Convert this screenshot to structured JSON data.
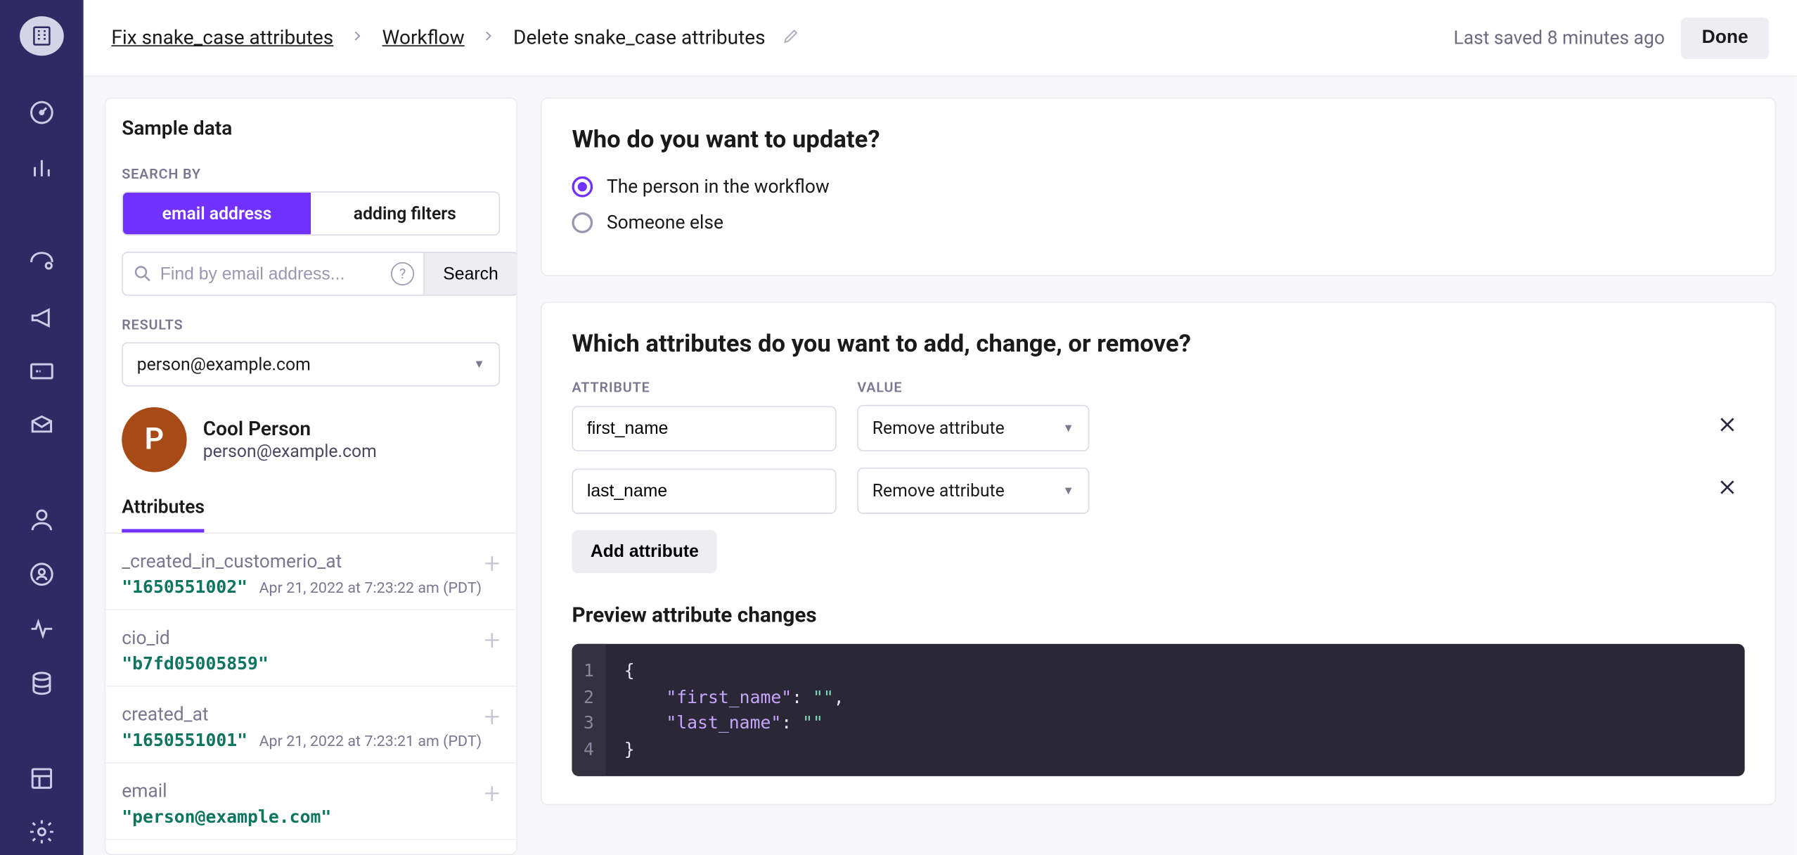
{
  "breadcrumb": {
    "root": "Fix snake_case attributes",
    "mid": "Workflow",
    "current": "Delete snake_case attributes"
  },
  "topbar": {
    "saved": "Last saved 8 minutes ago",
    "done": "Done"
  },
  "samplePanel": {
    "title": "Sample data",
    "searchBy": "SEARCH BY",
    "seg": {
      "email": "email address",
      "filters": "adding filters"
    },
    "searchPlaceholder": "Find by email address...",
    "searchButton": "Search",
    "resultsLabel": "RESULTS",
    "selectedResult": "person@example.com",
    "avatarLetter": "P",
    "personName": "Cool Person",
    "personEmail": "person@example.com",
    "tab": "Attributes",
    "attributes": [
      {
        "key": "_created_in_customerio_at",
        "value": "\"1650551002\"",
        "meta": "Apr 21, 2022 at 7:23:22 am (PDT)"
      },
      {
        "key": "cio_id",
        "value": "\"b7fd05005859\"",
        "meta": ""
      },
      {
        "key": "created_at",
        "value": "\"1650551001\"",
        "meta": "Apr 21, 2022 at 7:23:21 am (PDT)"
      },
      {
        "key": "email",
        "value": "\"person@example.com\"",
        "meta": ""
      }
    ]
  },
  "updateCard": {
    "heading": "Who do you want to update?",
    "opt1": "The person in the workflow",
    "opt2": "Someone else"
  },
  "attrCard": {
    "heading": "Which attributes do you want to add, change, or remove?",
    "colAttr": "ATTRIBUTE",
    "colVal": "VALUE",
    "rows": [
      {
        "attr": "first_name",
        "val": "Remove attribute"
      },
      {
        "attr": "last_name",
        "val": "Remove attribute"
      }
    ],
    "addBtn": "Add attribute",
    "previewHeading": "Preview attribute changes",
    "code": {
      "lines": [
        "1",
        "2",
        "3",
        "4"
      ],
      "body": "{\n    \"first_name\": \"\",\n    \"last_name\": \"\"\n}"
    }
  }
}
